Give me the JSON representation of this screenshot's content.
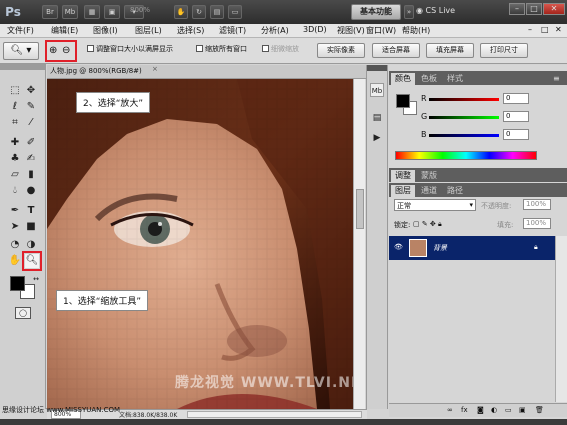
{
  "titlebar": {
    "app_logo": "Ps",
    "zoom_value": "800%",
    "workspace_label": "基本功能",
    "cslive_label": "CS Live",
    "window_buttons": [
      "–",
      "□",
      "✕"
    ]
  },
  "menu": {
    "items": [
      "文件(F)",
      "编辑(E)",
      "图像(I)",
      "图层(L)",
      "选择(S)",
      "滤镜(T)",
      "分析(A)",
      "3D(D)",
      "视图(V)",
      "窗口(W)",
      "帮助(H)"
    ],
    "window_buttons": [
      "–",
      "□",
      "✕"
    ]
  },
  "options": {
    "resize_windows": "调整窗口大小以满屏显示",
    "zoom_all_windows": "缩放所有窗口",
    "scrubby_zoom": "细微缩放",
    "actual_pixels": "实际像素",
    "fit_screen": "适合屏幕",
    "fill_screen": "填充屏幕",
    "print_size": "打印尺寸"
  },
  "document": {
    "tab_label": "人物.jpg @ 800%(RGB/8#)",
    "zoom_status": "800%",
    "doc_info": "文档:838.0K/838.0K"
  },
  "callouts": {
    "step1": "1、选择“缩放工具”",
    "step2": "2、选择“放大”"
  },
  "color_panel": {
    "tabs": [
      "颜色",
      "色板",
      "样式"
    ],
    "channels": [
      {
        "label": "R",
        "value": "0",
        "color": "#e02020"
      },
      {
        "label": "G",
        "value": "0",
        "color": "#20c020"
      },
      {
        "label": "B",
        "value": "0",
        "color": "#2040e0"
      }
    ]
  },
  "adjust_panel": {
    "tabs": [
      "调整",
      "蒙版"
    ]
  },
  "layers_panel": {
    "tabs": [
      "图层",
      "通道",
      "路径"
    ],
    "blend_mode": "正常",
    "opacity_label": "不透明度:",
    "opacity_value": "100%",
    "lock_label": "锁定:",
    "fill_label": "填充:",
    "fill_value": "100%",
    "layer_name": "背景"
  },
  "watermark": {
    "main": "腾龙视觉 WWW.TLVI.NET",
    "site": "思缘设计论坛 www.MISSYUAN.COM"
  },
  "colors": {
    "accent_red": "#e0202a",
    "layer_selected": "#0a246a"
  }
}
